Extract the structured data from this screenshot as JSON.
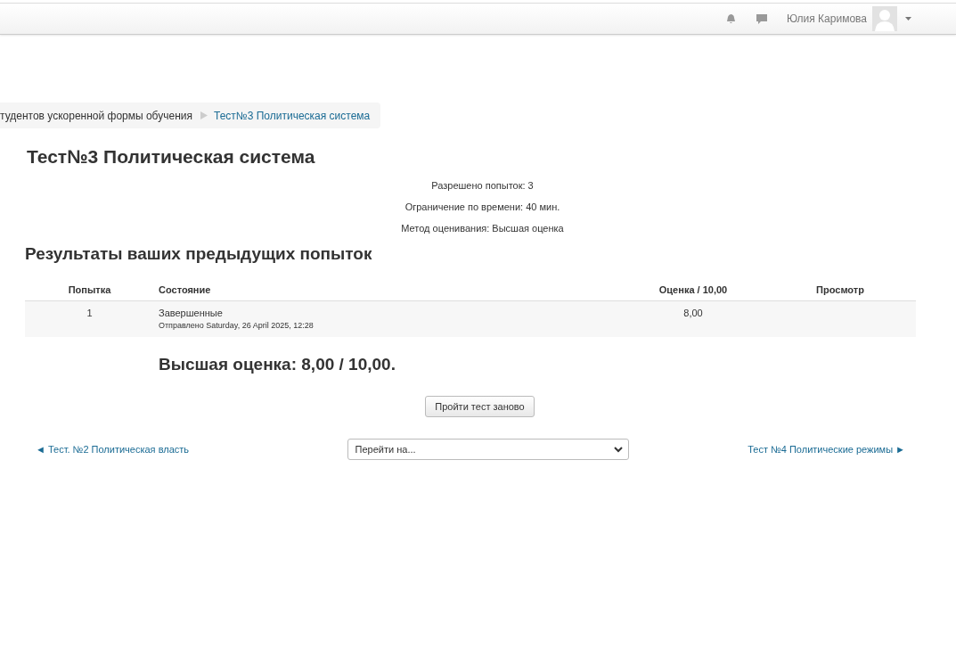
{
  "header": {
    "user_name": "Юлия Каримова"
  },
  "breadcrumb": [
    {
      "label": "тудентов ускоренной формы обучения",
      "current": false
    },
    {
      "label": "Тест№3 Политическая система",
      "current": true
    }
  ],
  "title": "Тест№3 Политическая система",
  "info": [
    "Разрешено попыток: 3",
    "Ограничение по времени: 40 мин.",
    "Метод оценивания: Высшая оценка"
  ],
  "results_heading": "Результаты ваших предыдущих попыток",
  "table": {
    "columns": [
      "Попытка",
      "Состояние",
      "Оценка / 10,00",
      "Просмотр"
    ],
    "rows": [
      {
        "attempt": "1",
        "state": "Завершенные",
        "submitted": "Отправлено Saturday, 26 April 2025, 12:28",
        "grade": "8,00"
      }
    ]
  },
  "highest_grade": "Высшая оценка: 8,00 / 10,00.",
  "retake_button": "Пройти тест заново",
  "nav": {
    "prev": "◄ Тест. №2 Политическая власть",
    "jump_placeholder": "Перейти на...",
    "next": "Тест №4 Политические режимы ►"
  }
}
